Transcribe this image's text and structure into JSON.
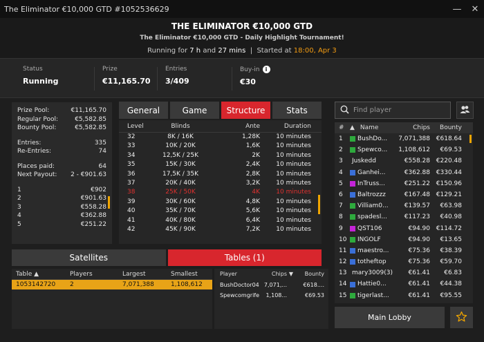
{
  "window": {
    "title": "The Eliminator €10,000 GTD #1052536629",
    "minimize": "—",
    "close": "✕"
  },
  "header": {
    "title": "THE ELIMINATOR €10,000 GTD",
    "subtitle": "The Eliminator €10,000 GTD - Daily Highlight Tournament!",
    "running_prefix": "Running for",
    "running_hours": "7 h",
    "running_and": "and",
    "running_mins": "27 mins",
    "sep": "|",
    "started_label": "Started at",
    "started_time": "18:00, Apr 3"
  },
  "stats": {
    "status_label": "Status",
    "status_value": "Running",
    "prize_label": "Prize",
    "prize_value": "€11,165.70",
    "entries_label": "Entries",
    "entries_value": "3/409",
    "buyin_label": "Buy-in",
    "buyin_value": "€30"
  },
  "left_panel": {
    "prize_pool_label": "Prize Pool:",
    "prize_pool": "€11,165.70",
    "regular_pool_label": "Regular Pool:",
    "regular_pool": "€5,582.85",
    "bounty_pool_label": "Bounty Pool:",
    "bounty_pool": "€5,582.85",
    "entries_label": "Entries:",
    "entries": "335",
    "reentries_label": "Re-Entries:",
    "reentries": "74",
    "places_paid_label": "Places paid:",
    "places_paid": "64",
    "next_payout_label": "Next Payout:",
    "next_payout": "2 - €901.63",
    "payouts": [
      {
        "place": "1",
        "amount": "€902"
      },
      {
        "place": "2",
        "amount": "€901.63"
      },
      {
        "place": "3",
        "amount": "€558.28"
      },
      {
        "place": "4",
        "amount": "€362.88"
      },
      {
        "place": "5",
        "amount": "€251.22"
      }
    ]
  },
  "tabs": [
    {
      "label": "General",
      "active": false
    },
    {
      "label": "Game",
      "active": false
    },
    {
      "label": "Structure",
      "active": true
    },
    {
      "label": "Stats",
      "active": false
    }
  ],
  "structure": {
    "headers": {
      "level": "Level",
      "blinds": "Blinds",
      "ante": "Ante",
      "duration": "Duration"
    },
    "rows": [
      {
        "level": "32",
        "blinds": "8K / 16K",
        "ante": "1,28K",
        "duration": "10 minutes"
      },
      {
        "level": "33",
        "blinds": "10K / 20K",
        "ante": "1,6K",
        "duration": "10 minutes"
      },
      {
        "level": "34",
        "blinds": "12,5K / 25K",
        "ante": "2K",
        "duration": "10 minutes"
      },
      {
        "level": "35",
        "blinds": "15K / 30K",
        "ante": "2,4K",
        "duration": "10 minutes"
      },
      {
        "level": "36",
        "blinds": "17,5K / 35K",
        "ante": "2,8K",
        "duration": "10 minutes"
      },
      {
        "level": "37",
        "blinds": "20K / 40K",
        "ante": "3,2K",
        "duration": "10 minutes"
      },
      {
        "level": "38",
        "blinds": "25K / 50K",
        "ante": "4K",
        "duration": "10 minutes",
        "current": true
      },
      {
        "level": "39",
        "blinds": "30K / 60K",
        "ante": "4,8K",
        "duration": "10 minutes"
      },
      {
        "level": "40",
        "blinds": "35K / 70K",
        "ante": "5,6K",
        "duration": "10 minutes"
      },
      {
        "level": "41",
        "blinds": "40K / 80K",
        "ante": "6,4K",
        "duration": "10 minutes"
      },
      {
        "level": "42",
        "blinds": "45K / 90K",
        "ante": "7,2K",
        "duration": "10 minutes"
      }
    ]
  },
  "bottom_tabs": [
    {
      "label": "Satellites",
      "active": false
    },
    {
      "label": "Tables (1)",
      "active": true
    }
  ],
  "tables": {
    "headers": {
      "table": "Table ▲",
      "players": "Players",
      "largest": "Largest",
      "smallest": "Smallest"
    },
    "rows": [
      {
        "table": "1053142720",
        "players": "2",
        "largest": "7,071,388",
        "smallest": "1,108,612"
      }
    ]
  },
  "table_players": {
    "headers": {
      "player": "Player",
      "chips": "Chips",
      "sort": "▼",
      "bounty": "Bounty"
    },
    "rows": [
      {
        "player": "BushDoctor04",
        "chips": "7,071,...",
        "bounty": "€618...."
      },
      {
        "player": "Spewcomgrife",
        "chips": "1,108...",
        "bounty": "€69.53"
      }
    ]
  },
  "search": {
    "placeholder": "Find player"
  },
  "players": {
    "headers": {
      "rank": "#",
      "sort": "▲",
      "name": "Name",
      "chips": "Chips",
      "bounty": "Bounty"
    },
    "rows": [
      {
        "rank": "1",
        "color": "#2eaa3d",
        "name": "BushDo...",
        "chips": "7,071,388",
        "bounty": "€618.64"
      },
      {
        "rank": "2",
        "color": "#2eaa3d",
        "name": "Spewco...",
        "chips": "1,108,612",
        "bounty": "€69.53"
      },
      {
        "rank": "3",
        "color": "",
        "name": "Juskedd",
        "chips": "€558.28",
        "bounty": "€220.48"
      },
      {
        "rank": "4",
        "color": "#3a6fd8",
        "name": "Ganhei...",
        "chips": "€362.88",
        "bounty": "€330.44"
      },
      {
        "rank": "5",
        "color": "#c424d8",
        "name": "InTruss...",
        "chips": "€251.22",
        "bounty": "€150.96"
      },
      {
        "rank": "6",
        "color": "#3a6fd8",
        "name": "Baltrozzz",
        "chips": "€167.48",
        "bounty": "€129.21"
      },
      {
        "rank": "7",
        "color": "#2eaa3d",
        "name": "Villiam0...",
        "chips": "€139.57",
        "bounty": "€63.98"
      },
      {
        "rank": "8",
        "color": "#2eaa3d",
        "name": "spadesl...",
        "chips": "€117.23",
        "bounty": "€40.98"
      },
      {
        "rank": "9",
        "color": "#c424d8",
        "name": "QST106",
        "chips": "€94.90",
        "bounty": "€114.72"
      },
      {
        "rank": "10",
        "color": "#2eaa3d",
        "name": "INGOLF",
        "chips": "€94.90",
        "bounty": "€13.65"
      },
      {
        "rank": "11",
        "color": "#3a6fd8",
        "name": "maestro...",
        "chips": "€75.36",
        "bounty": "€38.39"
      },
      {
        "rank": "12",
        "color": "#3a6fd8",
        "name": "totheftop",
        "chips": "€75.36",
        "bounty": "€59.70"
      },
      {
        "rank": "13",
        "color": "",
        "name": "mary3009(3)",
        "chips": "€61.41",
        "bounty": "€6.83"
      },
      {
        "rank": "14",
        "color": "#3a6fd8",
        "name": "Hattie0...",
        "chips": "€61.41",
        "bounty": "€44.38"
      },
      {
        "rank": "15",
        "color": "#2eaa3d",
        "name": "tigerlast...",
        "chips": "€61.41",
        "bounty": "€95.55"
      }
    ]
  },
  "footer": {
    "main_lobby": "Main Lobby"
  },
  "colors": {
    "accent_red": "#d8262d",
    "highlight_orange": "#f39c12",
    "selected_row": "#e8a317"
  }
}
